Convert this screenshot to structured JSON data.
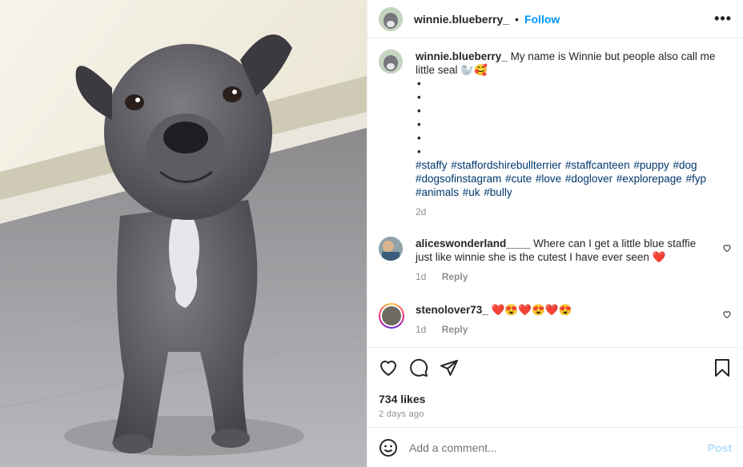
{
  "header": {
    "username": "winnie.blueberry_",
    "separator": "•",
    "follow_label": "Follow",
    "more_label": "•••"
  },
  "caption": {
    "username": "winnie.blueberry_",
    "text": "My name is Winnie but people also call me little seal 🦭🥰",
    "bullets": [
      "•",
      "•",
      "•",
      "•",
      "•",
      "•"
    ],
    "hashtags": "#staffy #staffordshirebullterrier #staffcanteen #puppy #dog #dogsofinstagram #cute #love #doglover #explorepage #fyp #animals #uk #bully",
    "time": "2d"
  },
  "comments": [
    {
      "username": "aliceswonderland____",
      "text": "Where can I get a little blue staffie just like winnie she is the cutest I have ever seen ❤️",
      "time": "1d",
      "reply_label": "Reply"
    },
    {
      "username": "stenolover73_",
      "text": "❤️😍❤️😍❤️😍",
      "time": "1d",
      "reply_label": "Reply"
    }
  ],
  "actions": {
    "likes": "734 likes",
    "posted_ago": "2 days ago"
  },
  "add_comment": {
    "placeholder": "Add a comment...",
    "post_label": "Post"
  },
  "colors": {
    "accent": "#0095f6",
    "hashtag": "#00376b",
    "muted": "#8e8e8e"
  }
}
